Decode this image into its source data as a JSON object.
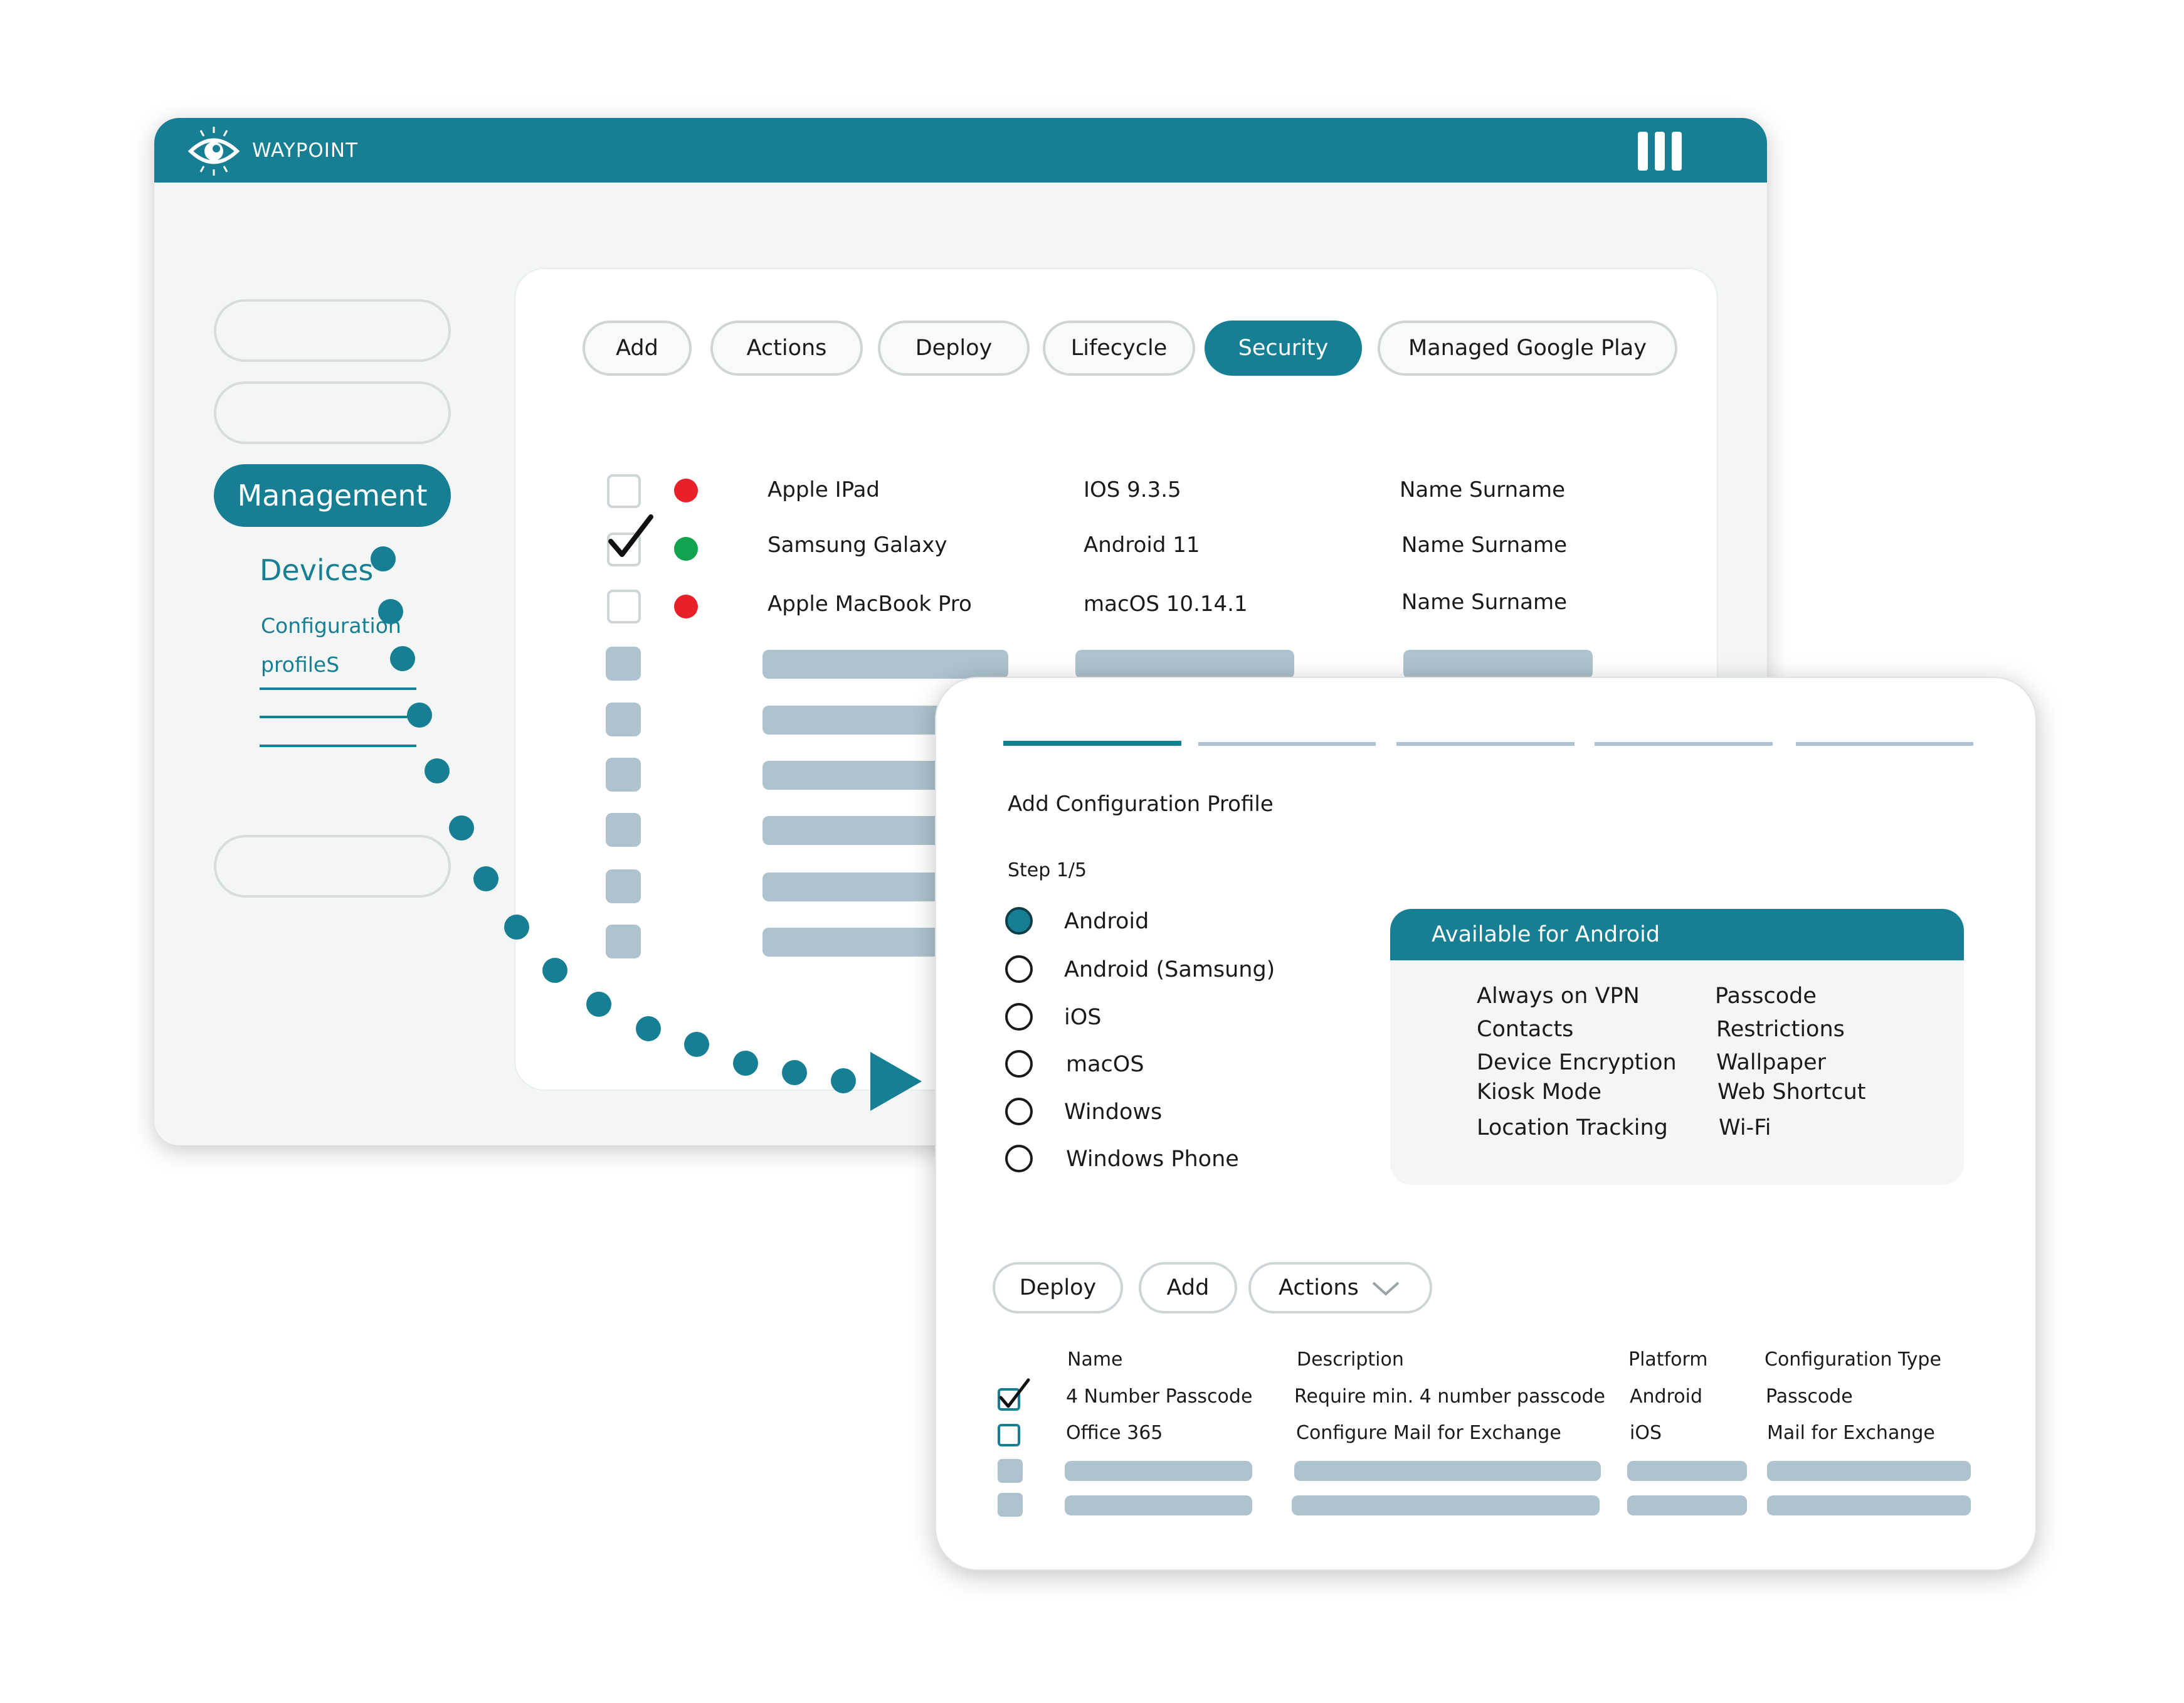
{
  "app": {
    "title": "WAYPOINT"
  },
  "sidebar": {
    "management_label": "Management",
    "devices_label": "Devices",
    "config_line1": "Configuration",
    "config_line2": "profileS"
  },
  "toolbar": {
    "tabs": [
      {
        "label": "Add"
      },
      {
        "label": "Actions"
      },
      {
        "label": "Deploy"
      },
      {
        "label": "Lifecycle"
      },
      {
        "label": "Security"
      },
      {
        "label": "Managed Google Play"
      }
    ],
    "active_tab": "Security"
  },
  "devices": [
    {
      "name": "Apple IPad",
      "os": "IOS 9.3.5",
      "owner": "Name Surname",
      "checked": false,
      "status_color": "#e8202a"
    },
    {
      "name": "Samsung Galaxy",
      "os": "Android 11",
      "owner": "Name Surname",
      "checked": true,
      "status_color": "#13a34f"
    },
    {
      "name": "Apple MacBook Pro",
      "os": "macOS 10.14.1",
      "owner": "Name Surname",
      "checked": false,
      "status_color": "#e8202a"
    }
  ],
  "wizard": {
    "title": "Add Configuration Profile",
    "step": "Step 1/5",
    "platforms": [
      {
        "label": "Android",
        "selected": true
      },
      {
        "label": "Android (Samsung)",
        "selected": false
      },
      {
        "label": "iOS",
        "selected": false
      },
      {
        "label": "macOS",
        "selected": false
      },
      {
        "label": "Windows",
        "selected": false
      },
      {
        "label": "Windows Phone",
        "selected": false
      }
    ],
    "available": {
      "heading": "Available for Android",
      "col1": [
        "Always on VPN",
        "Contacts",
        "Device Encryption",
        "Kiosk Mode",
        "Location Tracking"
      ],
      "col2": [
        "Passcode",
        "Restrictions",
        "Wallpaper",
        "Web Shortcut",
        "Wi-Fi"
      ]
    }
  },
  "profiles": {
    "buttons": {
      "deploy": "Deploy",
      "add": "Add",
      "actions": "Actions"
    },
    "columns": {
      "name": "Name",
      "description": "Description",
      "platform": "Platform",
      "type": "Configuration Type"
    },
    "rows": [
      {
        "name": "4 Number Passcode",
        "description": "Require min. 4 number passcode",
        "platform": "Android",
        "type": "Passcode",
        "checked": true
      },
      {
        "name": "Office 365",
        "description": "Configure Mail for Exchange",
        "platform": "iOS",
        "type": "Mail for Exchange",
        "checked": false
      }
    ]
  },
  "colors": {
    "brand": "#167f93",
    "placeholder": "#aec3cd",
    "status_red": "#e8202a",
    "status_green": "#13a34f"
  },
  "icons": [
    "eye-logo-icon",
    "menu-bars-icon",
    "checkmark-icon",
    "chevron-down-icon",
    "play-arrow-icon"
  ]
}
